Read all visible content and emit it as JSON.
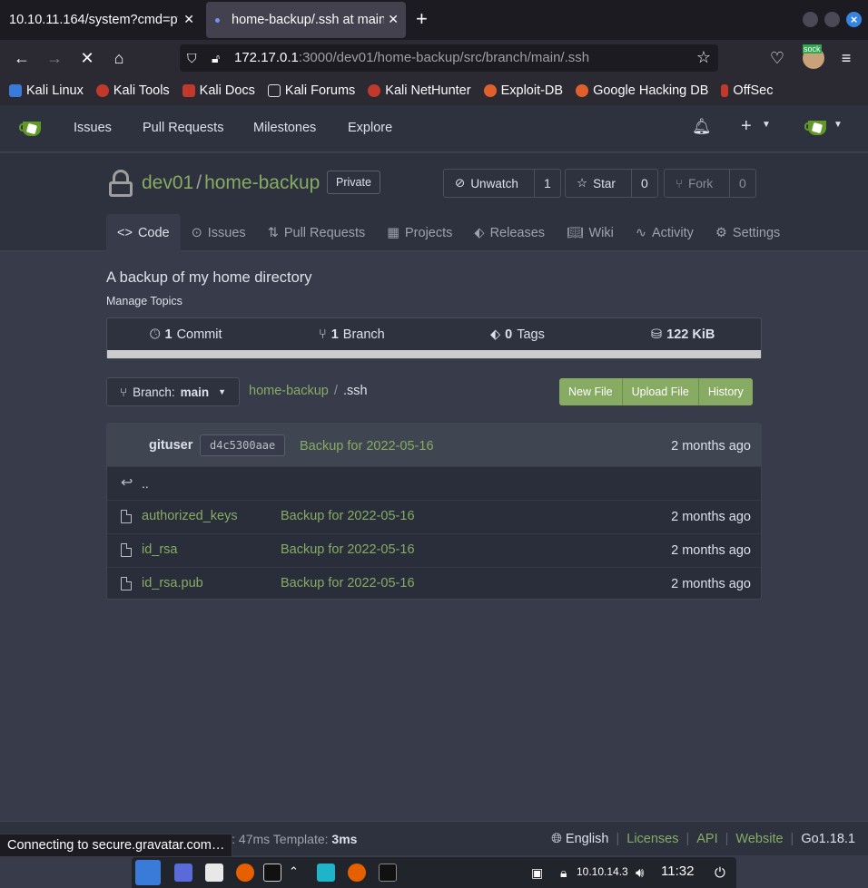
{
  "browser": {
    "tabs": [
      {
        "title": "10.10.11.164/system?cmd=py"
      },
      {
        "title": "home-backup/.ssh at main"
      }
    ],
    "url_host": "172.17.0.1",
    "url_rest": ":3000/dev01/home-backup/src/branch/main/.ssh",
    "bookmarks": [
      "Kali Linux",
      "Kali Tools",
      "Kali Docs",
      "Kali Forums",
      "Kali NetHunter",
      "Exploit-DB",
      "Google Hacking DB",
      "OffSec"
    ],
    "status_text": "Connecting to secure.gravatar.com…",
    "ext_badge": "sock"
  },
  "gitea_nav": {
    "items": [
      "Issues",
      "Pull Requests",
      "Milestones",
      "Explore"
    ]
  },
  "repo": {
    "owner": "dev01",
    "name": "home-backup",
    "visibility": "Private",
    "watch_label": "Unwatch",
    "watch_count": "1",
    "star_label": "Star",
    "star_count": "0",
    "fork_label": "Fork",
    "fork_count": "0",
    "tabs": [
      "Code",
      "Issues",
      "Pull Requests",
      "Projects",
      "Releases",
      "Wiki",
      "Activity",
      "Settings"
    ],
    "description": "A backup of my home directory",
    "manage_topics": "Manage Topics",
    "stats": {
      "commits_n": "1",
      "commits_l": "Commit",
      "branches_n": "1",
      "branches_l": "Branch",
      "tags_n": "0",
      "tags_l": "Tags",
      "size": "122 KiB"
    },
    "branch_label": "Branch:",
    "branch_name": "main",
    "breadcrumb_repo": "home-backup",
    "breadcrumb_sep": "/",
    "breadcrumb_dir": ".ssh",
    "buttons": [
      "New File",
      "Upload File",
      "History"
    ],
    "latest_commit": {
      "user": "gituser",
      "sha": "d4c5300aae",
      "message": "Backup for 2022-05-16",
      "age": "2 months ago"
    },
    "parent_dir": "..",
    "files": [
      {
        "name": "authorized_keys",
        "message": "Backup for 2022-05-16",
        "age": "2 months ago"
      },
      {
        "name": "id_rsa",
        "message": "Backup for 2022-05-16",
        "age": "2 months ago"
      },
      {
        "name": "id_rsa.pub",
        "message": "Backup for 2022-05-16",
        "age": "2 months ago"
      }
    ]
  },
  "footer": {
    "left": "Powered by Gitea Version: 1.16.6 Page: 47ms Template:",
    "template_time": "3ms",
    "language": "English",
    "links": [
      "Licenses",
      "API",
      "Website"
    ],
    "go_version": "Go1.18.1"
  },
  "taskbar": {
    "ip": "10.10.14.3",
    "clock": "11:32"
  },
  "colors": {
    "accent_green": "#87ab63",
    "gitea_green": "#609926",
    "bg": "#383c4a"
  }
}
